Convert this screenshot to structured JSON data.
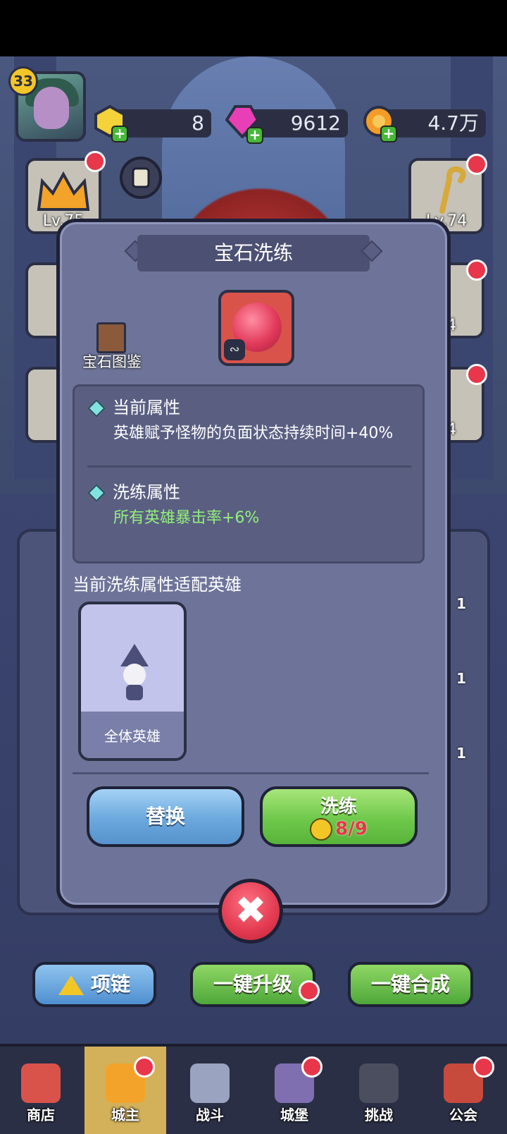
{
  "player": {
    "level": "33"
  },
  "resources": [
    {
      "name": "gold-gem",
      "value": "8"
    },
    {
      "name": "pink-crystal",
      "value": "9612"
    },
    {
      "name": "coin",
      "value": "4.7万"
    }
  ],
  "side_slots": {
    "crown_level": "Lv.75",
    "staff_level": "Lv.74",
    "right_2": "74",
    "right_3": "74"
  },
  "inventory_counts": [
    "1",
    "1",
    "1"
  ],
  "dialog": {
    "title": "宝石洗练",
    "book_label": "宝石图鉴",
    "current_attr_title": "当前属性",
    "current_attr_text": "英雄赋予怪物的负面状态持续时间+40%",
    "refine_attr_title": "洗练属性",
    "refine_attr_text": "所有英雄暴击率+6%",
    "hero_section_title": "当前洗练属性适配英雄",
    "hero_card_name": "全体英雄",
    "replace_label": "替换",
    "refine_label": "洗练",
    "refine_cost": "8/9",
    "close_symbol": "✖"
  },
  "bottom_buttons": {
    "necklace": "项链",
    "upgrade_all": "一键升级",
    "merge_all": "一键合成"
  },
  "nav": [
    {
      "label": "商店"
    },
    {
      "label": "城主"
    },
    {
      "label": "战斗"
    },
    {
      "label": "城堡"
    },
    {
      "label": "挑战"
    },
    {
      "label": "公会"
    }
  ],
  "colors": {
    "accent_red": "#e8364a",
    "accent_green": "#93f07a",
    "panel": "#6e7499"
  }
}
